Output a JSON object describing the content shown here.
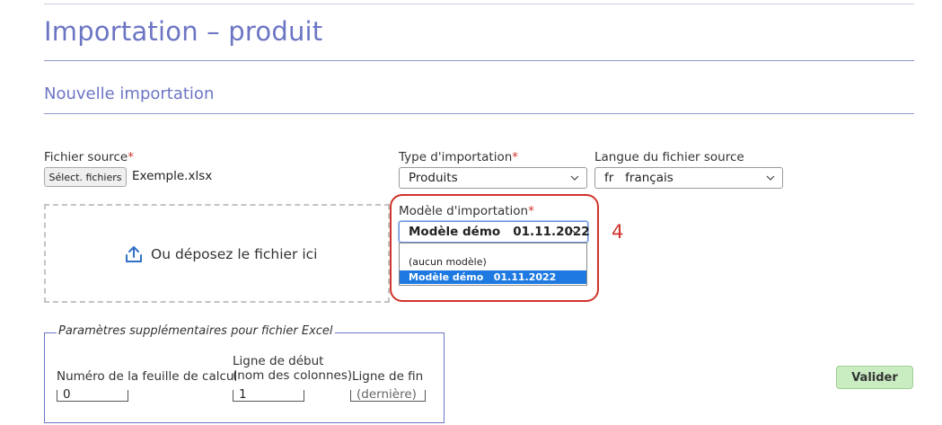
{
  "page": {
    "title": "Importation – produit",
    "section_title": "Nouvelle importation"
  },
  "source_file": {
    "label": "Fichier source",
    "required_mark": "*",
    "button_label": "Sélect. fichiers",
    "file_name": "Exemple.xlsx",
    "dropzone_text": "Ou déposez le fichier ici"
  },
  "import_type": {
    "label": "Type d'importation",
    "required_mark": "*",
    "value": "Produits"
  },
  "source_language": {
    "label": "Langue du fichier source",
    "value": "fr   français"
  },
  "import_model": {
    "label": "Modèle d'importation",
    "required_mark": "*",
    "value": "Modèle démo   01.11.2022",
    "options": [
      "(aucun modèle)",
      "Modèle démo   01.11.2022"
    ],
    "selected_index": 1
  },
  "annotation": {
    "number": "4",
    "color": "#d0342c"
  },
  "excel_params": {
    "legend": "Paramètres supplémentaires pour fichier Excel",
    "sheet_number_label": "Numéro de la feuille de calcul",
    "sheet_number_value": "0",
    "start_line_label_1": "Ligne de début",
    "start_line_label_2": "(nom des colonnes)",
    "start_line_value": "1",
    "end_line_label": "Ligne de fin",
    "end_line_placeholder": "(dernière)"
  },
  "actions": {
    "validate_label": "Valider"
  },
  "colors": {
    "accent": "#6c75c4",
    "required": "#d0342c",
    "validate_bg": "#c9ecc1",
    "selection": "#1e7ae0"
  }
}
